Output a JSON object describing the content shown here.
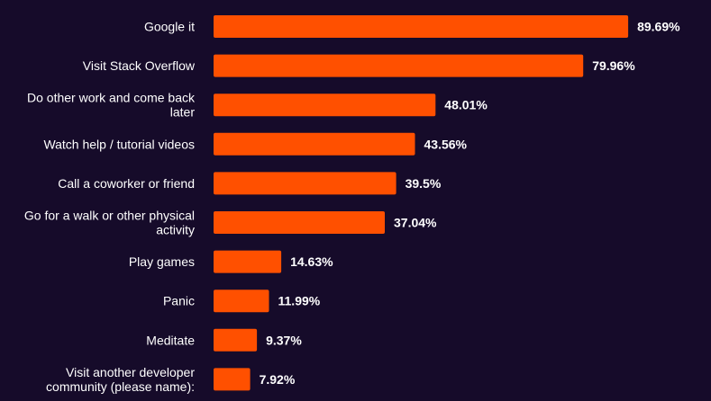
{
  "chart_data": {
    "type": "bar",
    "orientation": "horizontal",
    "categories": [
      "Google it",
      "Visit Stack Overflow",
      "Do other work and come back later",
      "Watch help / tutorial videos",
      "Call a coworker or friend",
      "Go for a walk or other physical activity",
      "Play games",
      "Panic",
      "Meditate",
      "Visit another developer community (please name):"
    ],
    "category_lines": [
      [
        "Google it"
      ],
      [
        "Visit Stack Overflow"
      ],
      [
        "Do other work and come back",
        "later"
      ],
      [
        "Watch help / tutorial videos"
      ],
      [
        "Call a coworker or friend"
      ],
      [
        "Go for a walk or other physical",
        "activity"
      ],
      [
        "Play games"
      ],
      [
        "Panic"
      ],
      [
        "Meditate"
      ],
      [
        "Visit another developer",
        "community (please name):"
      ]
    ],
    "values": [
      89.69,
      79.96,
      48.01,
      43.56,
      39.5,
      37.04,
      14.63,
      11.99,
      9.37,
      7.92
    ],
    "value_labels": [
      "89.69%",
      "79.96%",
      "48.01%",
      "43.56%",
      "39.5%",
      "37.04%",
      "14.63%",
      "11.99%",
      "9.37%",
      "7.92%"
    ],
    "xlim": [
      0,
      100
    ],
    "title": "",
    "xlabel": "",
    "ylabel": "",
    "grid": false,
    "legend": "none",
    "colors": {
      "background": "#160b2a",
      "bar": "#ff5000",
      "text": "#ffffff"
    }
  }
}
